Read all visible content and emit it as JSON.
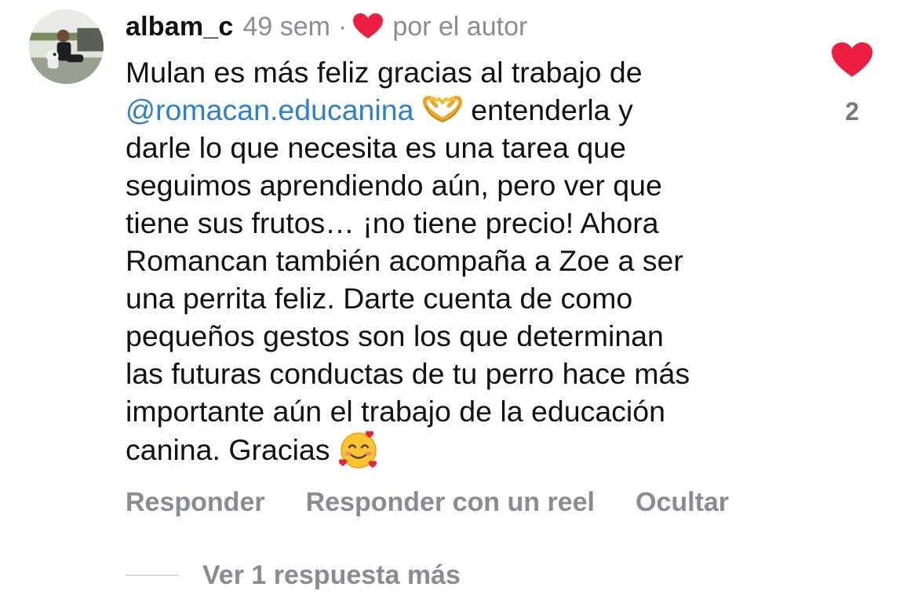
{
  "comment": {
    "username": "albam_c",
    "time": "49 sem",
    "separator": "·",
    "author_label": "por el autor",
    "text_lines": [
      {
        "segments": [
          {
            "text": "Mulan es más feliz gracias al trabajo de"
          }
        ]
      },
      {
        "mention": "@romacan.educanina",
        "emoji": "heart-hands-emoji",
        "after": " entenderla y"
      },
      {
        "segments": [
          {
            "text": "darle lo que necesita es una tarea que"
          }
        ]
      },
      {
        "segments": [
          {
            "text": "seguimos aprendiendo aún, pero ver que"
          }
        ]
      },
      {
        "segments": [
          {
            "text": "tiene sus frutos… ¡no tiene precio! Ahora"
          }
        ]
      },
      {
        "segments": [
          {
            "text": "Romancan también acompaña a Zoe a ser"
          }
        ]
      },
      {
        "segments": [
          {
            "text": "una perrita feliz. Darte cuenta de como"
          }
        ]
      },
      {
        "segments": [
          {
            "text": "pequeños gestos son los que determinan"
          }
        ]
      },
      {
        "segments": [
          {
            "text": "las futuras conductas de tu perro hace más"
          }
        ]
      },
      {
        "segments": [
          {
            "text": "importante aún el trabajo de la educación"
          }
        ]
      },
      {
        "before": "canina. Gracias ",
        "emoji": "smiling-face-with-hearts-emoji"
      }
    ],
    "like_count": "2",
    "actions": {
      "reply": "Responder",
      "reply_reel": "Responder con un reel",
      "hide": "Ocultar"
    },
    "view_replies": "Ver 1 respuesta más"
  },
  "colors": {
    "heart": "#ed1e3f",
    "mention": "#2f7fd0",
    "muted": "#8a8d93",
    "text": "#121212"
  },
  "icons": {
    "author_heart": "heart-icon",
    "like": "heart-icon"
  }
}
